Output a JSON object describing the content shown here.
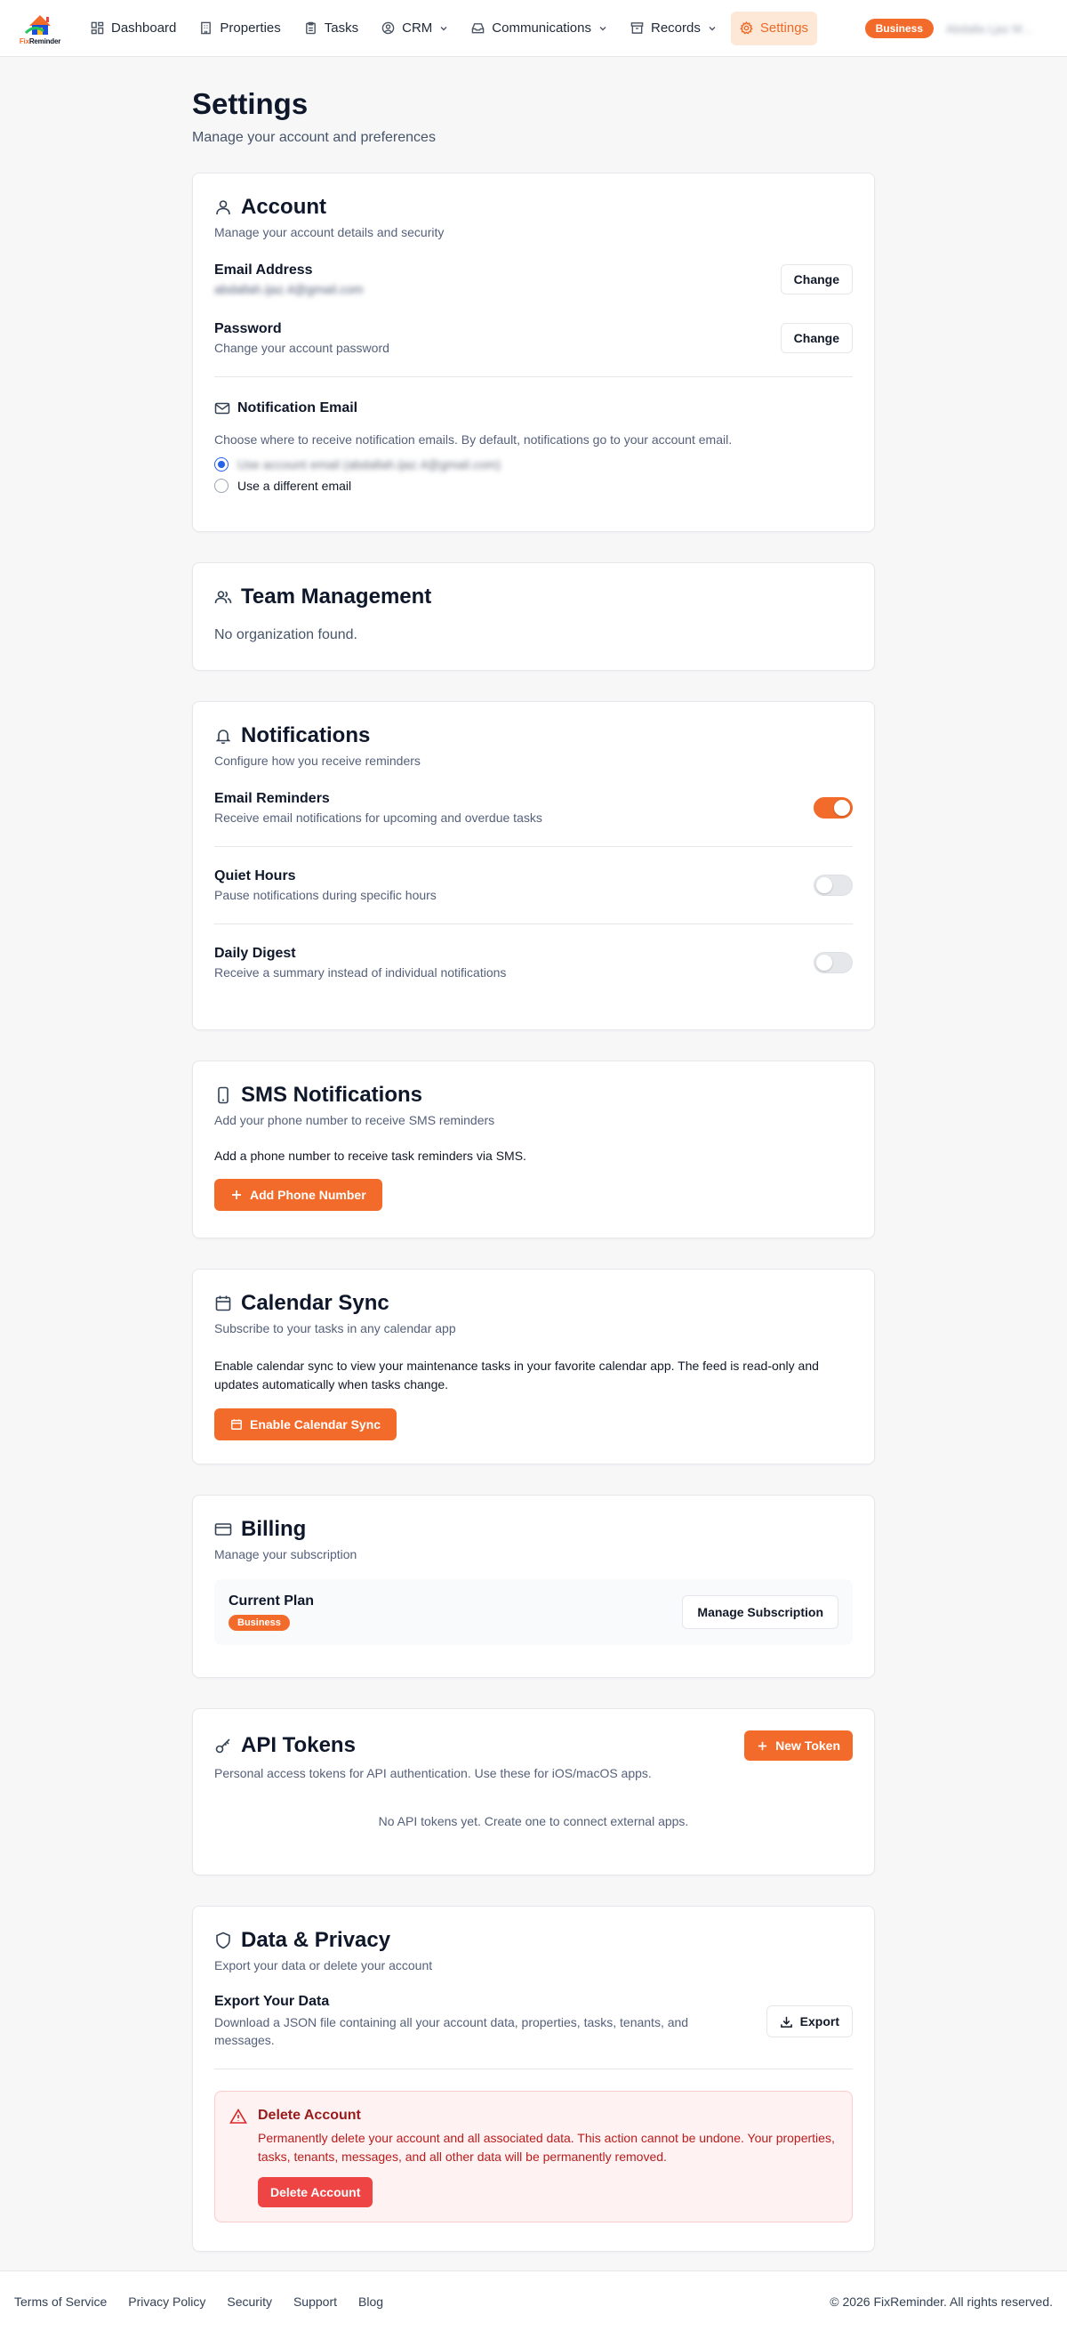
{
  "app": {
    "brand_fix": "Fix",
    "brand_rem": "Reminder"
  },
  "nav": {
    "items": [
      {
        "label": "Dashboard"
      },
      {
        "label": "Properties"
      },
      {
        "label": "Tasks"
      },
      {
        "label": "CRM"
      },
      {
        "label": "Communications"
      },
      {
        "label": "Records"
      },
      {
        "label": "Settings"
      }
    ],
    "plan_badge": "Business",
    "user_name": "Abdalla Ljaz M…"
  },
  "page": {
    "title": "Settings",
    "subtitle": "Manage your account and preferences"
  },
  "account": {
    "title": "Account",
    "desc": "Manage your account details and security",
    "email_label": "Email Address",
    "email_value": "abdallah.ijaz.4@gmail.com",
    "email_btn": "Change",
    "password_label": "Password",
    "password_desc": "Change your account password",
    "password_btn": "Change",
    "notif_email_title": "Notification Email",
    "notif_email_desc": "Choose where to receive notification emails. By default, notifications go to your account email.",
    "radio_1": "Use account email (abdallah.ijaz.4@gmail.com)",
    "radio_2": "Use a different email"
  },
  "team": {
    "title": "Team Management",
    "empty": "No organization found."
  },
  "notifications": {
    "title": "Notifications",
    "desc": "Configure how you receive reminders",
    "items": [
      {
        "label": "Email Reminders",
        "desc": "Receive email notifications for upcoming and overdue tasks",
        "on": true
      },
      {
        "label": "Quiet Hours",
        "desc": "Pause notifications during specific hours",
        "on": false
      },
      {
        "label": "Daily Digest",
        "desc": "Receive a summary instead of individual notifications",
        "on": false
      }
    ]
  },
  "sms": {
    "title": "SMS Notifications",
    "desc": "Add your phone number to receive SMS reminders",
    "body": "Add a phone number to receive task reminders via SMS.",
    "btn": "Add Phone Number"
  },
  "calendar": {
    "title": "Calendar Sync",
    "desc": "Subscribe to your tasks in any calendar app",
    "body": "Enable calendar sync to view your maintenance tasks in your favorite calendar app. The feed is read-only and updates automatically when tasks change.",
    "btn": "Enable Calendar Sync"
  },
  "billing": {
    "title": "Billing",
    "desc": "Manage your subscription",
    "plan_label": "Current Plan",
    "plan_badge": "Business",
    "btn": "Manage Subscription"
  },
  "api": {
    "title": "API Tokens",
    "desc": "Personal access tokens for API authentication. Use these for iOS/macOS apps.",
    "btn": "New Token",
    "empty": "No API tokens yet. Create one to connect external apps."
  },
  "privacy": {
    "title": "Data & Privacy",
    "desc": "Export your data or delete your account",
    "export_label": "Export Your Data",
    "export_desc": "Download a JSON file containing all your account data, properties, tasks, tenants, and messages.",
    "export_btn": "Export",
    "delete_title": "Delete Account",
    "delete_desc": "Permanently delete your account and all associated data. This action cannot be undone. Your properties, tasks, tenants, messages, and all other data will be permanently removed.",
    "delete_btn": "Delete Account"
  },
  "footer": {
    "links": [
      {
        "label": "Terms of Service"
      },
      {
        "label": "Privacy Policy"
      },
      {
        "label": "Security"
      },
      {
        "label": "Support"
      },
      {
        "label": "Blog"
      }
    ],
    "copyright": "© 2026 FixReminder. All rights reserved."
  },
  "colors": {
    "accent": "#f26b2a",
    "danger": "#ef4444",
    "radio": "#2563eb"
  }
}
